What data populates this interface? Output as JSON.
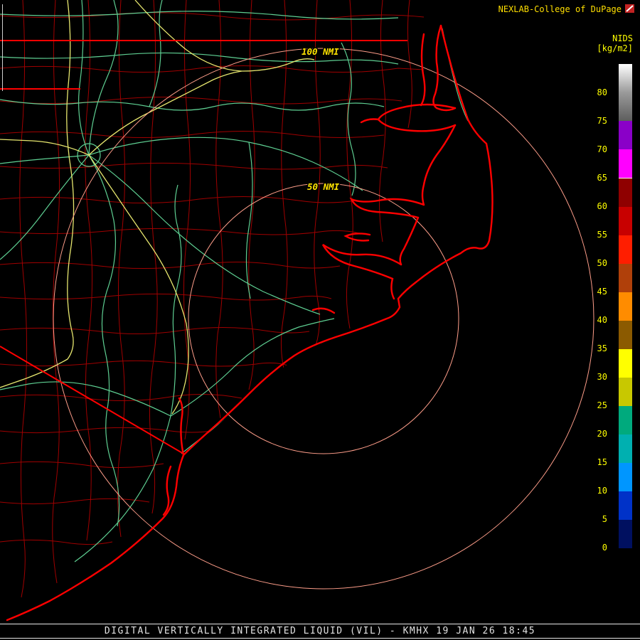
{
  "header": {
    "brand": "NEXLAB-College of DuPage",
    "product_label": "NIDS",
    "unit_label": "[kg/m2]"
  },
  "rings": {
    "inner_label": "50 NMI",
    "outer_label": "100 NMI"
  },
  "colorbar": {
    "unit": "kg/m2",
    "segments": [
      {
        "label": "80",
        "color": "#ffffff",
        "color2": "#9a9a9a"
      },
      {
        "label": "75",
        "color": "#9a9a9a",
        "color2": "#5e5e5e"
      },
      {
        "label": "70",
        "color": "#8a00c8"
      },
      {
        "label": "65",
        "color": "#ff00ff"
      },
      {
        "label": "60",
        "color": "#8f0000",
        "divider": true
      },
      {
        "label": "55",
        "color": "#c80000"
      },
      {
        "label": "50",
        "color": "#ff1e00"
      },
      {
        "label": "45",
        "color": "#b0400a"
      },
      {
        "label": "40",
        "color": "#ff8c00"
      },
      {
        "label": "35",
        "color": "#8b5a00"
      },
      {
        "label": "30",
        "color": "#ffff00"
      },
      {
        "label": "25",
        "color": "#c8c800"
      },
      {
        "label": "20",
        "color": "#00aa7d"
      },
      {
        "label": "15",
        "color": "#00b0b0"
      },
      {
        "label": "10",
        "color": "#0096ff"
      },
      {
        "label": "5",
        "color": "#0032c8"
      },
      {
        "label": "0",
        "color": "#001060"
      },
      {
        "label": "",
        "color": "#000000",
        "height": 20
      }
    ]
  },
  "footer": {
    "text": "DIGITAL VERTICALLY INTEGRATED LIQUID (VIL) - KMHX 19 JAN 26 18:45"
  },
  "colors": {
    "background": "#000000",
    "county_lines": "#a00000",
    "state_border": "#ff0000",
    "coastline": "#ff0000",
    "roads_primary": "#5ecf92",
    "roads_secondary": "#e6e66e",
    "range_rings": "#ff9e8a",
    "label_yellow": "#ffff00",
    "footer_text": "#e2e2e2"
  }
}
